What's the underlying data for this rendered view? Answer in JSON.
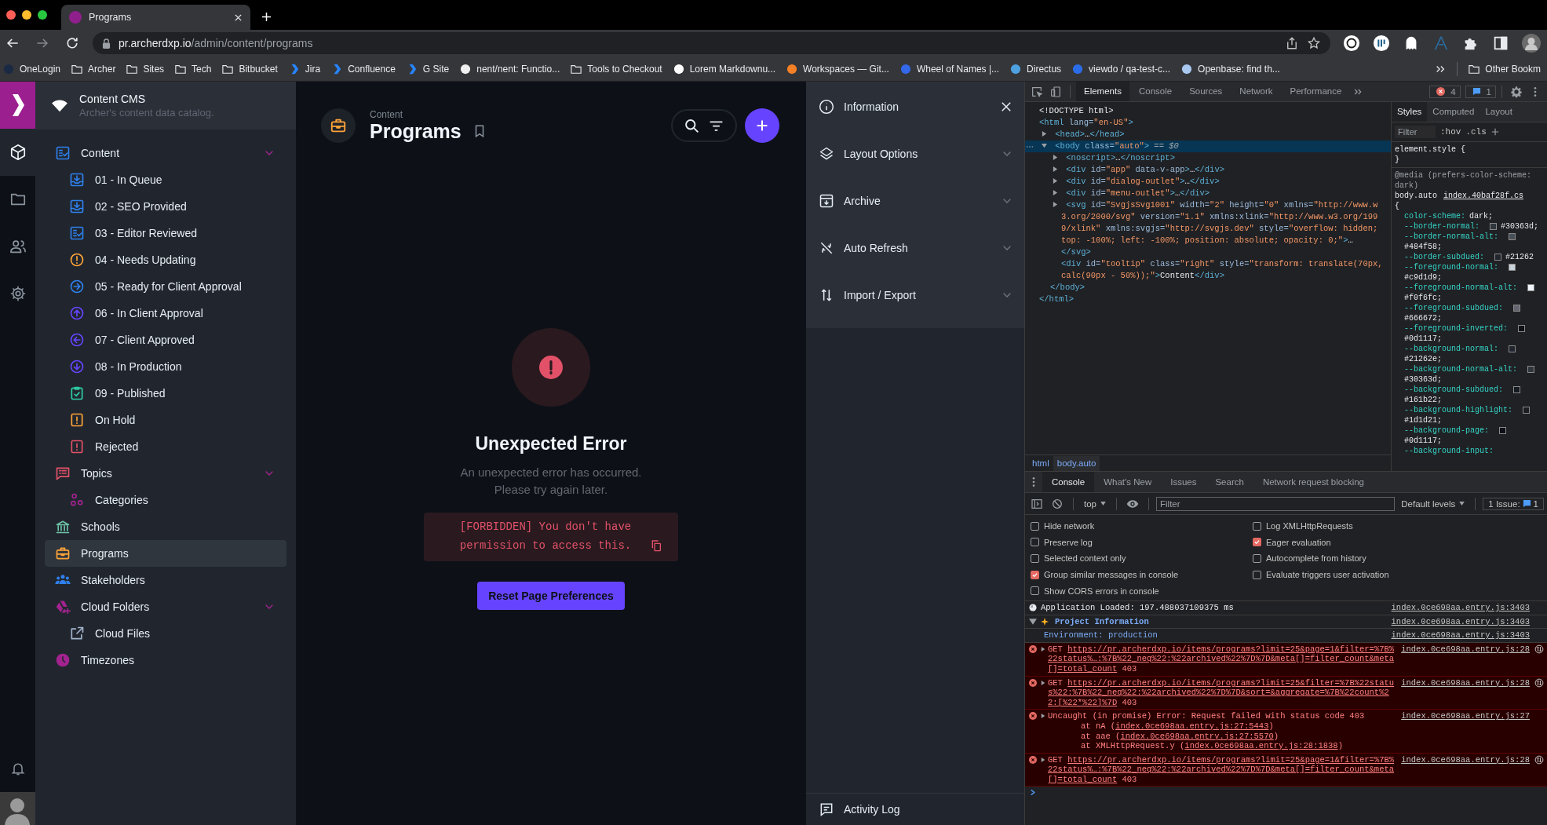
{
  "browser": {
    "tab": {
      "title": "Programs",
      "selected": true
    },
    "address": {
      "host": "pr.archerdxp.io",
      "path": "/admin/content/programs"
    },
    "bookmarks": [
      {
        "label": "OneLogin",
        "kind": "dot",
        "color": "#1b2a44"
      },
      {
        "label": "Archer",
        "kind": "folder"
      },
      {
        "label": "Sites",
        "kind": "folder"
      },
      {
        "label": "Tech",
        "kind": "folder"
      },
      {
        "label": "Bitbucket",
        "kind": "folder"
      },
      {
        "label": "Jira",
        "kind": "chevron",
        "color": "#2684ff"
      },
      {
        "label": "Confluence",
        "kind": "chevron",
        "color": "#2684ff"
      },
      {
        "label": "G Site",
        "kind": "chevron",
        "color": "#2684ff"
      },
      {
        "label": "nent/nent: Functio...",
        "kind": "dot",
        "color": "#f0f0f0"
      },
      {
        "label": "Tools to Checkout",
        "kind": "folder"
      },
      {
        "label": "Lorem Markdownu...",
        "kind": "dot",
        "color": "#ffffff"
      },
      {
        "label": "Workspaces — Git...",
        "kind": "dot",
        "color": "#f58025"
      },
      {
        "label": "Wheel of Names |...",
        "kind": "dot",
        "color": "#3369e8"
      },
      {
        "label": "Directus",
        "kind": "dot",
        "color": "#4ea1e0"
      },
      {
        "label": "viewdo / qa-test-c...",
        "kind": "dot",
        "color": "#2b6de8"
      },
      {
        "label": "Openbase: find th...",
        "kind": "dot",
        "color": "#a8c8f0"
      }
    ],
    "other_bookmarks": "Other Bookm"
  },
  "modules": [
    {
      "selected": true
    },
    {
      "selected": false
    },
    {
      "selected": false
    },
    {
      "selected": false
    }
  ],
  "nav": {
    "title": "Content CMS",
    "subtitle": "Archer's content data catalog.",
    "items": [
      {
        "label": "Content",
        "color": "#2f80ed",
        "selected": false,
        "expanded": true,
        "children": [
          {
            "label": "01 - In Queue",
            "color": "#2f80ed",
            "selected": false
          },
          {
            "label": "02 - SEO Provided",
            "color": "#2f80ed",
            "selected": false
          },
          {
            "label": "03 - Editor Reviewed",
            "color": "#2f80ed",
            "selected": false
          },
          {
            "label": "04 - Needs Updating",
            "color": "#ffa439",
            "selected": false
          },
          {
            "label": "05 - Ready for Client Approval",
            "color": "#2f80ed",
            "selected": false
          },
          {
            "label": "06 - In Client Approval",
            "color": "#6644ff",
            "selected": false
          },
          {
            "label": "07 - Client Approved",
            "color": "#6644ff",
            "selected": false
          },
          {
            "label": "08 - In Production",
            "color": "#6644ff",
            "selected": false
          },
          {
            "label": "09 - Published",
            "color": "#2ecda7",
            "selected": false
          },
          {
            "label": "On Hold",
            "color": "#ffa439",
            "selected": false
          },
          {
            "label": "Rejected",
            "color": "#e35169",
            "selected": false
          }
        ]
      },
      {
        "label": "Topics",
        "color": "#e35169",
        "selected": false,
        "expanded": true,
        "children": [
          {
            "label": "Categories",
            "color": "#a2238f",
            "selected": false
          }
        ]
      },
      {
        "label": "Schools",
        "color": "#6fc3a9",
        "selected": false
      },
      {
        "label": "Programs",
        "color": "#ffa439",
        "selected": true
      },
      {
        "label": "Stakeholders",
        "color": "#2f80ed",
        "selected": false
      },
      {
        "label": "Cloud Folders",
        "color": "#a2238f",
        "selected": false,
        "expanded": true,
        "children": [
          {
            "label": "Cloud Files",
            "color": "#a2b5cd",
            "selected": false
          }
        ]
      },
      {
        "label": "Timezones",
        "color": "#a2238f",
        "selected": false
      }
    ]
  },
  "main": {
    "breadcrumb": "Content",
    "title": "Programs",
    "error": {
      "title": "Unexpected Error",
      "message": "An unexpected error has occurred.\nPlease try again later.",
      "code": "[FORBIDDEN] You don't have permission to access this.",
      "button": "Reset Page Preferences"
    }
  },
  "panel": {
    "sections": [
      {
        "label": "Information",
        "kind": "header"
      },
      {
        "label": "Layout Options",
        "kind": "section",
        "expanded": false
      },
      {
        "label": "Archive",
        "kind": "section",
        "expanded": false
      },
      {
        "label": "Auto Refresh",
        "kind": "section",
        "expanded": false
      },
      {
        "label": "Import / Export",
        "kind": "section",
        "expanded": false
      }
    ],
    "footer": "Activity Log"
  },
  "devtools": {
    "tabs": [
      {
        "label": "Elements",
        "selected": true
      },
      {
        "label": "Console",
        "selected": false
      },
      {
        "label": "Sources",
        "selected": false
      },
      {
        "label": "Network",
        "selected": false
      },
      {
        "label": "Performance",
        "selected": false
      }
    ],
    "error_count": "4",
    "message_count": "1",
    "dom": [
      {
        "selected": false,
        "tokens": [
          {
            "kind": "plain",
            "text": "<!DOCTYPE html>"
          }
        ]
      },
      {
        "selected": false,
        "tokens": [
          {
            "kind": "tag",
            "text": "<html"
          },
          {
            "kind": "attr",
            "text": " lang="
          },
          {
            "kind": "value",
            "text": "\"en-US\""
          },
          {
            "kind": "tag",
            "text": ">"
          }
        ],
        "close": "</html>",
        "children": [
          {
            "selected": false,
            "expanded": false,
            "tokens": [
              {
                "kind": "tag",
                "text": "<head>"
              },
              {
                "kind": "plain",
                "text": "…"
              },
              {
                "kind": "tag",
                "text": "</head>"
              }
            ]
          },
          {
            "selected": true,
            "expanded": true,
            "tokens": [
              {
                "kind": "tag",
                "text": "<body"
              },
              {
                "kind": "attr",
                "text": " class="
              },
              {
                "kind": "value",
                "text": "\"auto\""
              },
              {
                "kind": "tag",
                "text": ">"
              },
              {
                "kind": "dim",
                "text": " == $0"
              }
            ],
            "close": "</body>",
            "children": [
              {
                "selected": false,
                "expanded": false,
                "tokens": [
                  {
                    "kind": "tag",
                    "text": "<noscript>"
                  },
                  {
                    "kind": "plain",
                    "text": "…"
                  },
                  {
                    "kind": "tag",
                    "text": "</noscript>"
                  }
                ]
              },
              {
                "selected": false,
                "expanded": false,
                "tokens": [
                  {
                    "kind": "tag",
                    "text": "<div"
                  },
                  {
                    "kind": "attr",
                    "text": " id="
                  },
                  {
                    "kind": "value",
                    "text": "\"app\""
                  },
                  {
                    "kind": "attr",
                    "text": " data-v-app"
                  },
                  {
                    "kind": "tag",
                    "text": ">"
                  },
                  {
                    "kind": "plain",
                    "text": "…"
                  },
                  {
                    "kind": "tag",
                    "text": "</div>"
                  }
                ]
              },
              {
                "selected": false,
                "expanded": false,
                "tokens": [
                  {
                    "kind": "tag",
                    "text": "<div"
                  },
                  {
                    "kind": "attr",
                    "text": " id="
                  },
                  {
                    "kind": "value",
                    "text": "\"dialog-outlet\""
                  },
                  {
                    "kind": "tag",
                    "text": ">"
                  },
                  {
                    "kind": "plain",
                    "text": "…"
                  },
                  {
                    "kind": "tag",
                    "text": "</div>"
                  }
                ]
              },
              {
                "selected": false,
                "expanded": false,
                "tokens": [
                  {
                    "kind": "tag",
                    "text": "<div"
                  },
                  {
                    "kind": "attr",
                    "text": " id="
                  },
                  {
                    "kind": "value",
                    "text": "\"menu-outlet\""
                  },
                  {
                    "kind": "tag",
                    "text": ">"
                  },
                  {
                    "kind": "plain",
                    "text": "…"
                  },
                  {
                    "kind": "tag",
                    "text": "</div>"
                  }
                ]
              },
              {
                "selected": false,
                "expanded": false,
                "close": "</svg>",
                "tokens": [
                  {
                    "kind": "tag",
                    "text": "<svg"
                  },
                  {
                    "kind": "attr",
                    "text": " id="
                  },
                  {
                    "kind": "value",
                    "text": "\"SvgjsSvg1001\""
                  },
                  {
                    "kind": "attr",
                    "text": " width="
                  },
                  {
                    "kind": "value",
                    "text": "\"2\""
                  },
                  {
                    "kind": "attr",
                    "text": " height="
                  },
                  {
                    "kind": "value",
                    "text": "\"0\""
                  },
                  {
                    "kind": "attr",
                    "text": " xmlns="
                  },
                  {
                    "kind": "value",
                    "text": "\"http://www.w3.org/2000/svg\""
                  },
                  {
                    "kind": "attr",
                    "text": " version="
                  },
                  {
                    "kind": "value",
                    "text": "\"1.1\""
                  },
                  {
                    "kind": "attr",
                    "text": " xmlns:xlink="
                  },
                  {
                    "kind": "value",
                    "text": "\"http://www.w3.org/1999/xlink\""
                  },
                  {
                    "kind": "attr",
                    "text": " xmlns:svgjs="
                  },
                  {
                    "kind": "value",
                    "text": "\"http://svgjs.dev\""
                  },
                  {
                    "kind": "attr",
                    "text": " style="
                  },
                  {
                    "kind": "value",
                    "text": "\"overflow: hidden; top: -100%; left: -100%; position: absolute; opacity: 0;\""
                  },
                  {
                    "kind": "tag",
                    "text": ">"
                  },
                  {
                    "kind": "plain",
                    "text": "…"
                  }
                ]
              },
              {
                "selected": false,
                "tokens": [
                  {
                    "kind": "tag",
                    "text": "<div"
                  },
                  {
                    "kind": "attr",
                    "text": " id="
                  },
                  {
                    "kind": "value",
                    "text": "\"tooltip\""
                  },
                  {
                    "kind": "attr",
                    "text": " class="
                  },
                  {
                    "kind": "value",
                    "text": "\"right\""
                  },
                  {
                    "kind": "attr",
                    "text": " style="
                  },
                  {
                    "kind": "value",
                    "text": "\"transform: translate(70px, calc(90px - 50%));\""
                  },
                  {
                    "kind": "tag",
                    "text": ">"
                  },
                  {
                    "kind": "plain",
                    "text": "Content"
                  },
                  {
                    "kind": "tag",
                    "text": "</div>"
                  }
                ]
              }
            ]
          }
        ]
      }
    ],
    "breadcrumbs": [
      {
        "label": "html",
        "selected": false
      },
      {
        "label": "body.auto",
        "selected": true
      }
    ],
    "styles": {
      "tabs": [
        {
          "label": "Styles",
          "selected": true
        },
        {
          "label": "Computed",
          "selected": false
        },
        {
          "label": "Layout",
          "selected": false
        }
      ],
      "filter_placeholder": "Filter",
      "hov": ":hov",
      "cls": ".cls",
      "element_rule": {
        "open": "element.style {",
        "close": "}"
      },
      "media": "@media (prefers-color-scheme: dark)",
      "selector": "body.auto",
      "source": "index.40baf28f.cs",
      "open": "{",
      "props": [
        {
          "name": "color-scheme:",
          "value": "dark;"
        },
        {
          "name": "--border-normal:",
          "color": "#30363d",
          "value": "#30363d;"
        },
        {
          "name": "--border-normal-alt:",
          "color": "#484f58",
          "value": "#484f58;"
        },
        {
          "name": "--border-subdued:",
          "color": "#21262e",
          "value": "#21262"
        },
        {
          "name": "--foreground-normal:",
          "color": "#c9d1d9",
          "value": "#c9d1d9;"
        },
        {
          "name": "--foreground-normal-alt:",
          "color": "#f0f6fc",
          "value": "#f0f6fc;"
        },
        {
          "name": "--foreground-subdued:",
          "color": "#666672",
          "value": "#666672;"
        },
        {
          "name": "--foreground-inverted:",
          "color": "#0d1117",
          "value": "#0d1117;"
        },
        {
          "name": "--background-normal:",
          "color": "#21262e",
          "value": "#21262e;"
        },
        {
          "name": "--background-normal-alt:",
          "color": "#30363d",
          "value": "#30363d;"
        },
        {
          "name": "--background-subdued:",
          "color": "#161b22",
          "value": "#161b22;"
        },
        {
          "name": "--background-highlight:",
          "color": "#1d1d21",
          "value": "#1d1d21;"
        },
        {
          "name": "--background-page:",
          "color": "#0d1117",
          "value": "#0d1117;"
        },
        {
          "name": "--background-input:"
        }
      ]
    },
    "console": {
      "tabs": [
        {
          "label": "Console",
          "selected": true
        },
        {
          "label": "What's New",
          "selected": false
        },
        {
          "label": "Issues",
          "selected": false
        },
        {
          "label": "Search",
          "selected": false
        },
        {
          "label": "Network request blocking",
          "selected": false
        }
      ],
      "context": "top",
      "filter_placeholder": "Filter",
      "levels": "Default levels",
      "issues_label": "1 Issue:",
      "issues_count": "1",
      "settings": [
        {
          "label": "Hide network",
          "checked": false
        },
        {
          "label": "Log XMLHttpRequests",
          "checked": false
        },
        {
          "label": "Preserve log",
          "checked": false
        },
        {
          "label": "Eager evaluation",
          "checked": true
        },
        {
          "label": "Selected context only",
          "checked": false
        },
        {
          "label": "Autocomplete from history",
          "checked": false
        },
        {
          "label": "Group similar messages in console",
          "checked": true
        },
        {
          "label": "Evaluate triggers user activation",
          "checked": false
        },
        {
          "label": "Show CORS errors in console",
          "checked": false
        }
      ],
      "messages": [
        {
          "kind": "log",
          "text": "Application Loaded: 197.488037109375 ms",
          "source": "index.0ce698aa.entry.js:3403"
        },
        {
          "kind": "group",
          "text": "Project Information",
          "expanded": true,
          "source": "index.0ce698aa.entry.js:3403"
        },
        {
          "kind": "child",
          "text": "Environment: production",
          "source": "index.0ce698aa.entry.js:3403"
        },
        {
          "kind": "request",
          "method": "GET",
          "url": "https://pr.archerdxp.io/items/programs?limit=25&page=1&filter=%7B%22status%…:%7B%22_neq%22:%22archived%22%7D%7D&meta[]=filter_count&meta[]=total_count",
          "status": "403",
          "source": "index.0ce698aa.entry.js:28"
        },
        {
          "kind": "request",
          "method": "GET",
          "url": "https://pr.archerdxp.io/items/programs?limit=25&filter=%7B%22status%22:%7B%22_neq%22:%22archived%22%7D%7D&sort=&aggregate=%7B%22count%22:[%22*%22]%7D",
          "status": "403",
          "source": "index.0ce698aa.entry.js:28"
        },
        {
          "kind": "exception",
          "text": "Uncaught (in promise) Error: Request failed with status code 403",
          "source": "index.0ce698aa.entry.js:27",
          "stack": [
            {
              "before": "at nA (",
              "link": "index.0ce698aa.entry.js:27:5443",
              "after": ")"
            },
            {
              "before": "at aae (",
              "link": "index.0ce698aa.entry.js:27:5570",
              "after": ")"
            },
            {
              "before": "at XMLHttpRequest.y (",
              "link": "index.0ce698aa.entry.js:28:1838",
              "after": ")"
            }
          ]
        },
        {
          "kind": "request",
          "method": "GET",
          "url": "https://pr.archerdxp.io/items/programs?limit=25&page=1&filter=%7B%22status%…:%7B%22_neq%22:%22archived%22%7D%7D&meta[]=filter_count&meta[]=total_count",
          "status": "403",
          "source": "index.0ce698aa.entry.js:28"
        }
      ]
    }
  }
}
